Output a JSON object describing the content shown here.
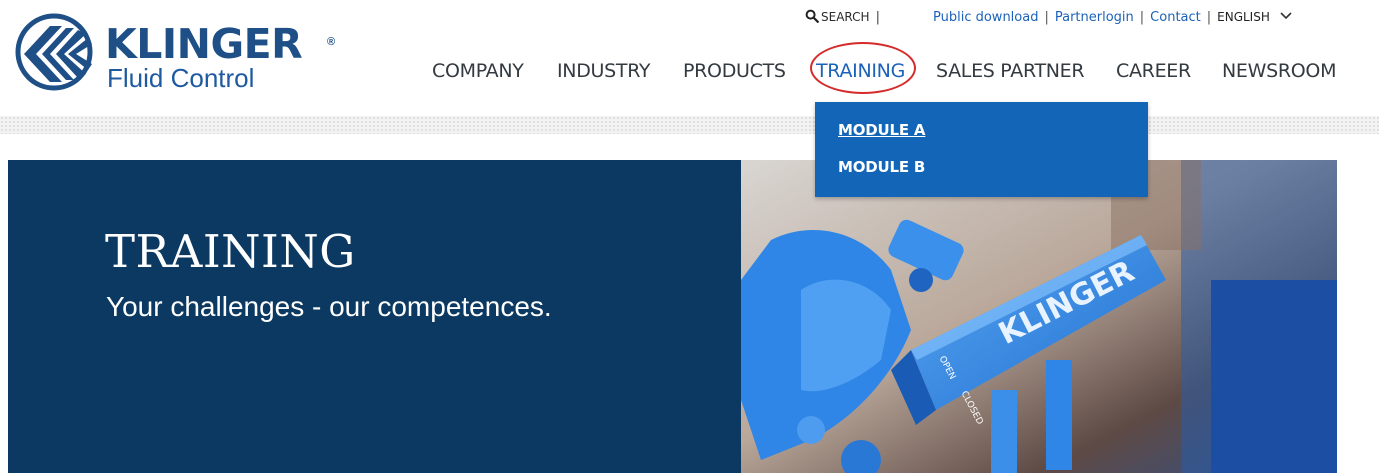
{
  "brand": {
    "name": "KLINGER",
    "registered_mark": "®",
    "subtitle": "Fluid Control",
    "color": "#1e4f86"
  },
  "utility_bar": {
    "search_icon": "magnifier-icon",
    "search_label": "SEARCH",
    "separator": "|",
    "links": [
      "Public download",
      "Partnerlogin",
      "Contact"
    ],
    "language": "ENGLISH",
    "language_icon": "chevron-down-icon",
    "link_color": "#1c62b9"
  },
  "main_nav": {
    "items": [
      "COMPANY",
      "INDUSTRY",
      "PRODUCTS",
      "TRAINING",
      "SALES PARTNER",
      "CAREER",
      "NEWSROOM"
    ],
    "active": "TRAINING",
    "highlight_color": "#d62b2b"
  },
  "dropdown": {
    "items": [
      "MODULE A",
      "MODULE B"
    ],
    "hovered": "MODULE A",
    "background": "#1366b7"
  },
  "hero": {
    "title": "TRAINING",
    "subtitle": "Your challenges - our competences.",
    "panel_color": "#0c3962",
    "image": {
      "icon": "valve-handle-photo",
      "handle_text": "KLINGER",
      "label_open": "OPEN",
      "label_closed": "CLOSED"
    }
  }
}
